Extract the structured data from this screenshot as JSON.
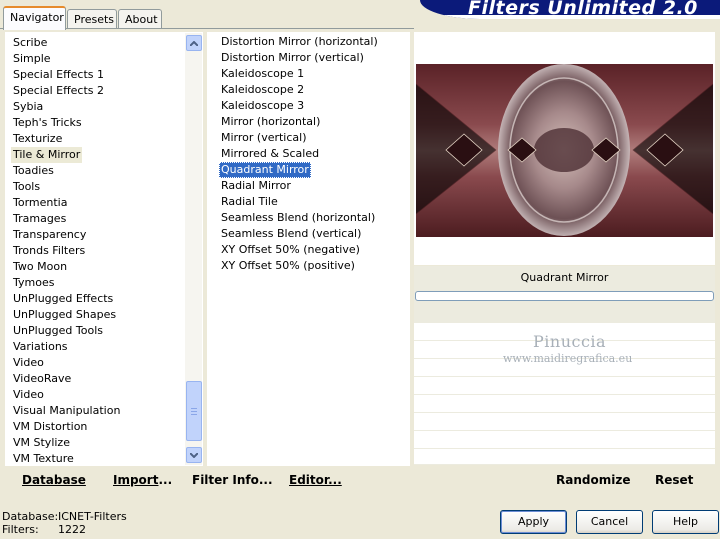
{
  "tabs": [
    {
      "label": "Navigator"
    },
    {
      "label": "Presets"
    },
    {
      "label": "About"
    }
  ],
  "banner": {
    "title": "Filters Unlimited 2.0"
  },
  "categories": [
    "Scribe",
    "Simple",
    "Special Effects 1",
    "Special Effects 2",
    "Sybia",
    "Teph's Tricks",
    "Texturize",
    "Tile & Mirror",
    "Toadies",
    "Tools",
    "Tormentia",
    "Tramages",
    "Transparency",
    "Tronds Filters",
    "Two Moon",
    "Tymoes",
    "UnPlugged Effects",
    "UnPlugged Shapes",
    "UnPlugged Tools",
    "Variations",
    "Video",
    "VideoRave",
    "Video",
    "Visual Manipulation",
    "VM Distortion",
    "VM Stylize",
    "VM Texture"
  ],
  "selected_category": "Tile & Mirror",
  "filters": [
    "Distortion Mirror (horizontal)",
    "Distortion Mirror (vertical)",
    "Kaleidoscope 1",
    "Kaleidoscope 2",
    "Kaleidoscope 3",
    "Mirror (horizontal)",
    "Mirror (vertical)",
    "Mirrored & Scaled",
    "Quadrant Mirror",
    "Radial Mirror",
    "Radial Tile",
    "Seamless Blend (horizontal)",
    "Seamless Blend (vertical)",
    "XY Offset 50% (negative)",
    "XY Offset 50% (positive)"
  ],
  "selected_filter": "Quadrant Mirror",
  "preview": {
    "filter_name": "Quadrant Mirror"
  },
  "watermark": {
    "name": "Pinuccia",
    "url": "www.maidiregrafica.eu"
  },
  "bottom_links": {
    "database": "Database",
    "import_pre": "Import",
    "import_post": "...",
    "filter_info": "Filter Info...",
    "editor": "Editor...",
    "randomize": "Randomize",
    "reset": "Reset"
  },
  "status": {
    "database_label": "Database:",
    "database_value": "ICNET-Filters",
    "filters_label": "Filters:",
    "filters_value": "1222"
  },
  "buttons": {
    "apply": "Apply",
    "cancel": "Cancel",
    "help": "Help"
  },
  "colors": {
    "selection": "#316ac5",
    "banner": "#0b1a7a",
    "face": "#ece9d8"
  }
}
